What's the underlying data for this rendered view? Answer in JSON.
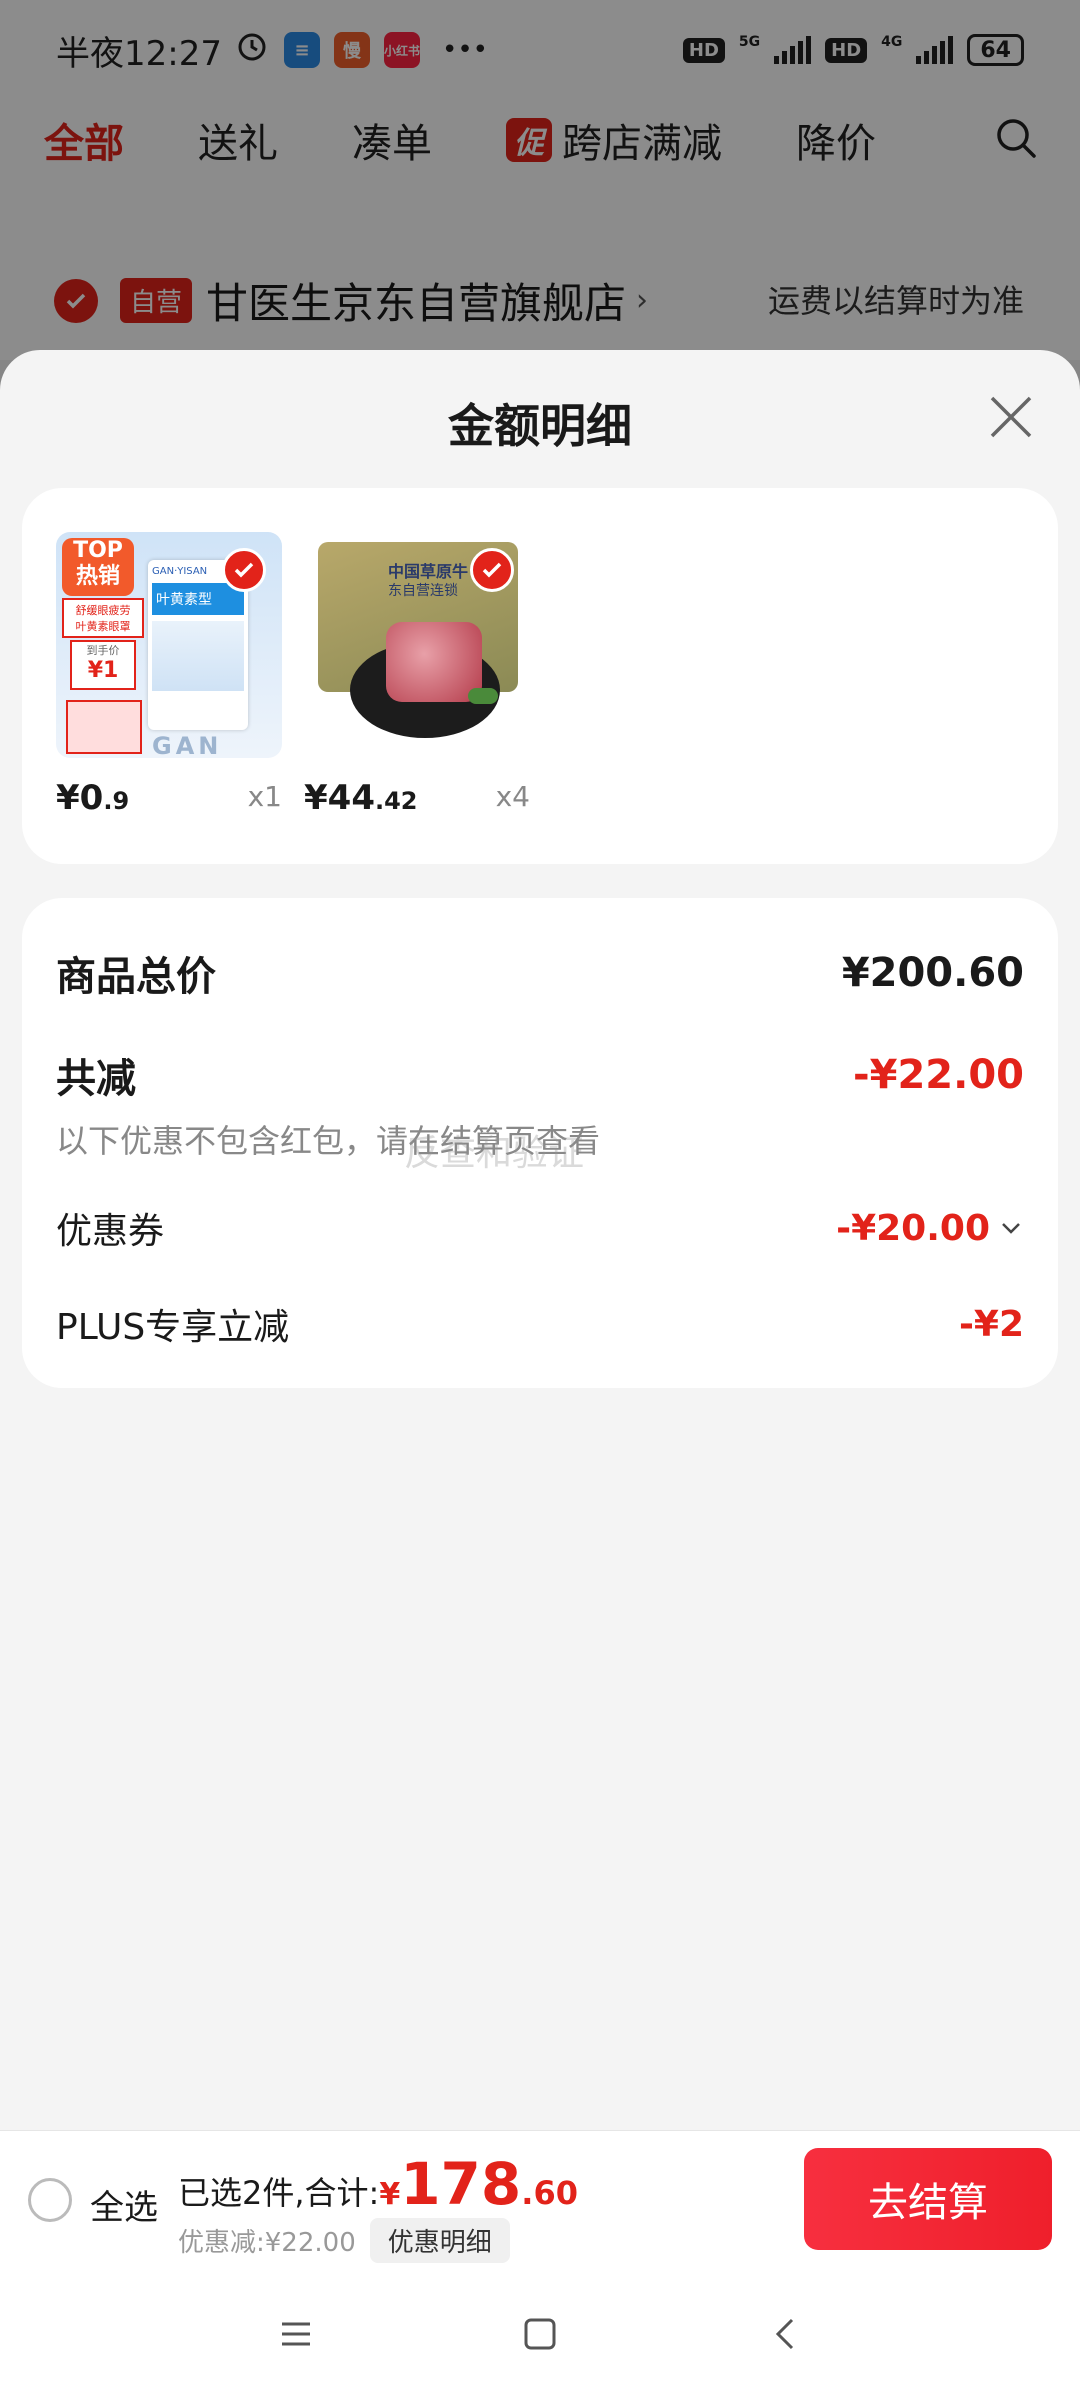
{
  "status_bar": {
    "time": "半夜12:27",
    "app_badges": [
      "慢",
      "小红书"
    ],
    "more": "•••",
    "hd": "HD",
    "net1": "5G",
    "net2": "4G",
    "battery": "64"
  },
  "top_tabs": [
    {
      "label": "全部",
      "active": true
    },
    {
      "label": "送礼",
      "active": false
    },
    {
      "label": "凑单",
      "active": false
    },
    {
      "label": "跨店满减",
      "badge": "促",
      "active": false
    },
    {
      "label": "降价",
      "active": false
    }
  ],
  "store": {
    "tag": "自营",
    "name": "甘医生京东自营旗舰店",
    "arrow": "›",
    "shipping_note": "运费以结算时为准"
  },
  "sheet": {
    "title": "金额明细"
  },
  "products": [
    {
      "price_int": "¥0",
      "price_dec": ".9",
      "qty": "x1",
      "thumb": {
        "top_badge": "TOP",
        "hot_badge": "热销",
        "tag1": "舒缓眼疲劳",
        "tag2": "叶黄素眼罩",
        "tag3": "到手价",
        "tag4": "¥1",
        "box_brand": "GAN·YISAN",
        "box_title": "叶黄素型"
      }
    },
    {
      "price_int": "¥44",
      "price_dec": ".42",
      "qty": "x4",
      "thumb": {
        "bag_text": "中国草原牛",
        "bag_text2": "东自营连锁"
      }
    }
  ],
  "summary": {
    "subtotal_label": "商品总价",
    "subtotal_value": "¥200.60",
    "reduction_label": "共减",
    "reduction_value": "-¥22.00",
    "note": "以下优惠不包含红包，请在结算页查看",
    "watermark": "反查和验证",
    "coupon_label": "优惠券",
    "coupon_value": "-¥20.00",
    "plus_label": "PLUS专享立减",
    "plus_value": "-¥2"
  },
  "bottom_bar": {
    "select_all": "全选",
    "selected_prefix": "已选2件,合计:",
    "yen": "¥",
    "total_int": "178",
    "total_dec": ".60",
    "discount": "优惠减:¥22.00",
    "detail_chip": "优惠明细",
    "checkout": "去结算"
  },
  "colors": {
    "accent": "#e2231a",
    "button": "#f72f3f"
  }
}
